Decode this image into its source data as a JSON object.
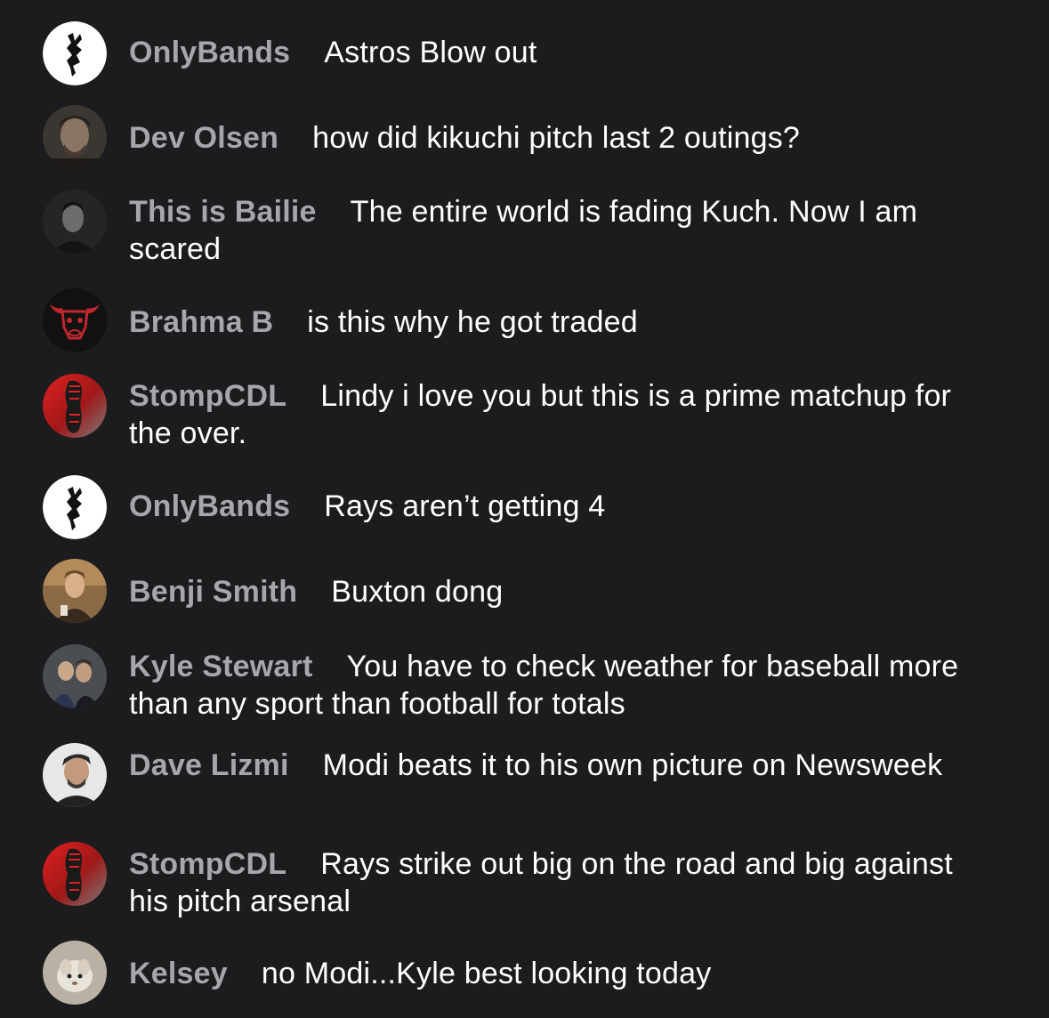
{
  "messages": [
    {
      "author": "OnlyBands",
      "text": "Astros Blow out",
      "avatar": "onlybands-logo"
    },
    {
      "author": "Dev Olsen",
      "text": "how did kikuchi pitch last 2 outings?",
      "avatar": "photo-dev-olsen"
    },
    {
      "author": "This is Bailie",
      "text": "The entire world is fading Kuch. Now I am scared",
      "avatar": "photo-bailie"
    },
    {
      "author": "Brahma B",
      "text": "is this why he got traded",
      "avatar": "bull-logo"
    },
    {
      "author": "StompCDL",
      "text": "Lindy i love you but this is a prime matchup for the over.",
      "avatar": "stomp-boot-logo"
    },
    {
      "author": "OnlyBands",
      "text": "Rays aren’t getting 4",
      "avatar": "onlybands-logo"
    },
    {
      "author": "Benji Smith",
      "text": "Buxton dong",
      "avatar": "photo-benji"
    },
    {
      "author": "Kyle Stewart",
      "text": "You have to check weather for baseball more than any sport than football for totals",
      "avatar": "photo-kyle"
    },
    {
      "author": "Dave Lizmi",
      "text": "Modi beats it to his own picture on Newsweek",
      "avatar": "photo-dave"
    },
    {
      "author": "StompCDL",
      "text": "Rays strike out big on the road and big against his pitch arsenal",
      "avatar": "stomp-boot-logo"
    },
    {
      "author": "Kelsey",
      "text": "no Modi...Kyle best looking today",
      "avatar": "photo-kelsey"
    }
  ],
  "colors": {
    "background": "#1c1c1e",
    "author": "#a6a6ab",
    "message": "#ffffff"
  }
}
